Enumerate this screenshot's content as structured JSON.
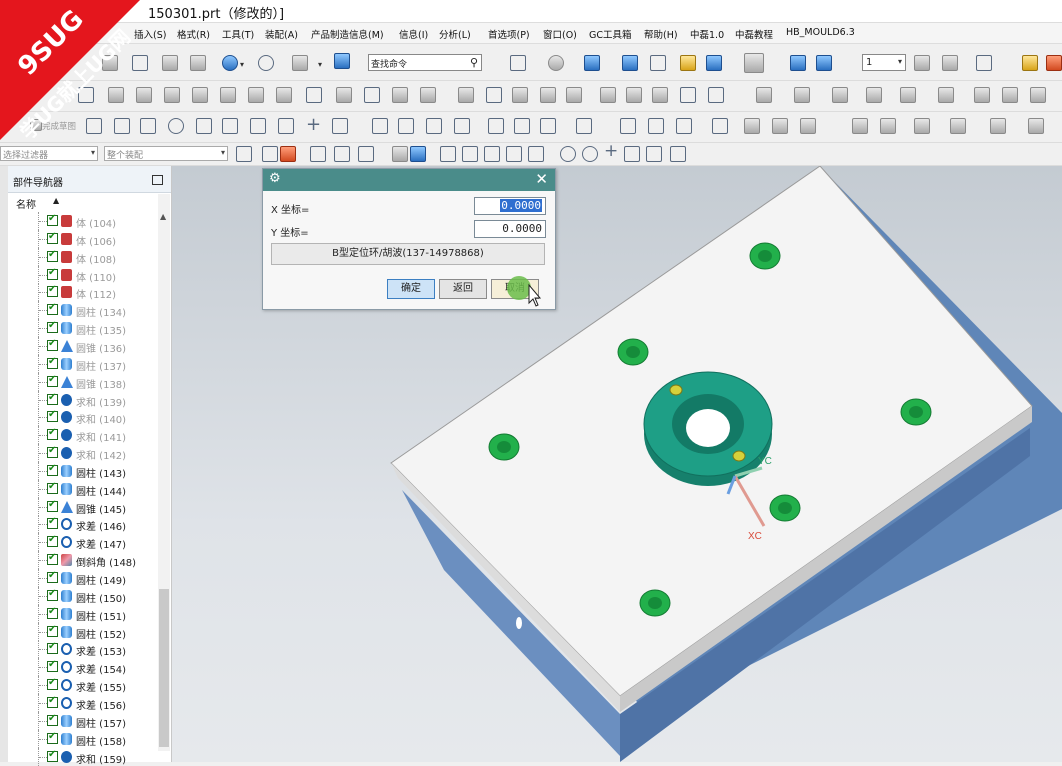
{
  "window": {
    "title": "150301.prt（修改的）]"
  },
  "watermark": {
    "line1": "9SUG",
    "line2": "学UG就上UG网"
  },
  "menubar": {
    "items": [
      "插入(S)",
      "格式(R)",
      "工具(T)",
      "装配(A)",
      "产品制造信息(M)",
      "信息(I)",
      "分析(L)",
      "首选项(P)",
      "窗口(O)",
      "GC工具箱",
      "帮助(H)",
      "中磊1.0",
      "中磊教程",
      "HB_MOULD6.3"
    ]
  },
  "toolbar": {
    "search_placeholder": "查找命令",
    "layer_value": "1",
    "sketch_label": "完成草图",
    "filter_label": "选择过滤器",
    "assembly_label": "整个装配"
  },
  "navigator": {
    "title": "部件导航器",
    "column_name": "名称",
    "items": [
      {
        "label": "体 (104)",
        "icon": "body",
        "dim": true
      },
      {
        "label": "体 (106)",
        "icon": "body",
        "dim": true
      },
      {
        "label": "体 (108)",
        "icon": "body",
        "dim": true
      },
      {
        "label": "体 (110)",
        "icon": "body",
        "dim": true
      },
      {
        "label": "体 (112)",
        "icon": "body",
        "dim": true
      },
      {
        "label": "圆柱 (134)",
        "icon": "cyl",
        "dim": true
      },
      {
        "label": "圆柱 (135)",
        "icon": "cyl",
        "dim": true
      },
      {
        "label": "圆锥 (136)",
        "icon": "cone",
        "dim": true
      },
      {
        "label": "圆柱 (137)",
        "icon": "cyl",
        "dim": true
      },
      {
        "label": "圆锥 (138)",
        "icon": "cone",
        "dim": true
      },
      {
        "label": "求和 (139)",
        "icon": "unite",
        "dim": true
      },
      {
        "label": "求和 (140)",
        "icon": "unite",
        "dim": true
      },
      {
        "label": "求和 (141)",
        "icon": "unite",
        "dim": true
      },
      {
        "label": "求和 (142)",
        "icon": "unite",
        "dim": true
      },
      {
        "label": "圆柱 (143)",
        "icon": "cyl",
        "dim": false
      },
      {
        "label": "圆柱 (144)",
        "icon": "cyl",
        "dim": false
      },
      {
        "label": "圆锥 (145)",
        "icon": "cone",
        "dim": false
      },
      {
        "label": "求差 (146)",
        "icon": "subtr",
        "dim": false
      },
      {
        "label": "求差 (147)",
        "icon": "subtr",
        "dim": false
      },
      {
        "label": "倒斜角 (148)",
        "icon": "chamf",
        "dim": false
      },
      {
        "label": "圆柱 (149)",
        "icon": "cyl",
        "dim": false
      },
      {
        "label": "圆柱 (150)",
        "icon": "cyl",
        "dim": false
      },
      {
        "label": "圆柱 (151)",
        "icon": "cyl",
        "dim": false
      },
      {
        "label": "圆柱 (152)",
        "icon": "cyl",
        "dim": false
      },
      {
        "label": "求差 (153)",
        "icon": "subtr",
        "dim": false
      },
      {
        "label": "求差 (154)",
        "icon": "subtr",
        "dim": false
      },
      {
        "label": "求差 (155)",
        "icon": "subtr",
        "dim": false
      },
      {
        "label": "求差 (156)",
        "icon": "subtr",
        "dim": false
      },
      {
        "label": "圆柱 (157)",
        "icon": "cyl",
        "dim": false
      },
      {
        "label": "圆柱 (158)",
        "icon": "cyl",
        "dim": false
      },
      {
        "label": "求和 (159)",
        "icon": "unite",
        "dim": false
      }
    ]
  },
  "dialog": {
    "x_label": "X 坐标=",
    "x_value": "0.0000",
    "y_label": "Y 坐标=",
    "y_value": "0.0000",
    "banner": "B型定位环/胡波(137-14978868)",
    "ok_label": "确定",
    "back_label": "返回",
    "cancel_label": "取消"
  },
  "viewport": {
    "axis_yc": "YC",
    "axis_xc": "XC",
    "colors": {
      "plate_top": "#f4f4f4",
      "plate_side": "#5f86b8",
      "ring": "#1e9f86",
      "screw": "#22b04b"
    }
  }
}
